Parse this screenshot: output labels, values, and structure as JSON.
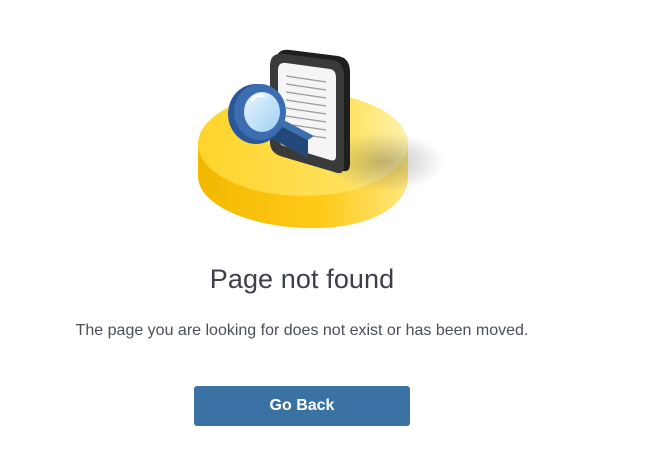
{
  "illustration": {
    "icon": "document-magnifier-icon",
    "colors": {
      "platform": "#FFD93A",
      "device": "#2E2E2E",
      "magnifier": "#2F5E9E"
    }
  },
  "title": "Page not found",
  "message": "The page you are looking for does not exist or has been moved.",
  "button": {
    "label": "Go Back",
    "color": "#3A73A3"
  }
}
